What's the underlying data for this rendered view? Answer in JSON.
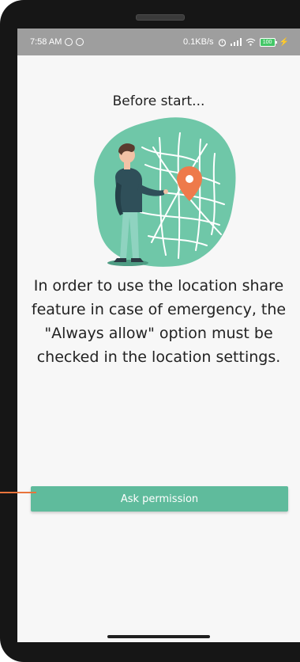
{
  "status_bar": {
    "time": "7:58 AM",
    "network_speed": "0.1KB/s",
    "battery_level": "100",
    "icons": [
      "sync-icon",
      "sync-icon",
      "alarm-icon",
      "signal-icon",
      "wifi-icon",
      "battery-icon",
      "charging-icon"
    ]
  },
  "screen": {
    "title": "Before start...",
    "message": "In order to use the location share feature in case of emergency, the \"Always allow\" option must be checked in the location settings.",
    "button_label": "Ask permission"
  },
  "colors": {
    "accent": "#5fbb9c",
    "pin": "#ee7a4b",
    "status_bar": "#9e9e9e",
    "background": "#f7f7f7"
  }
}
